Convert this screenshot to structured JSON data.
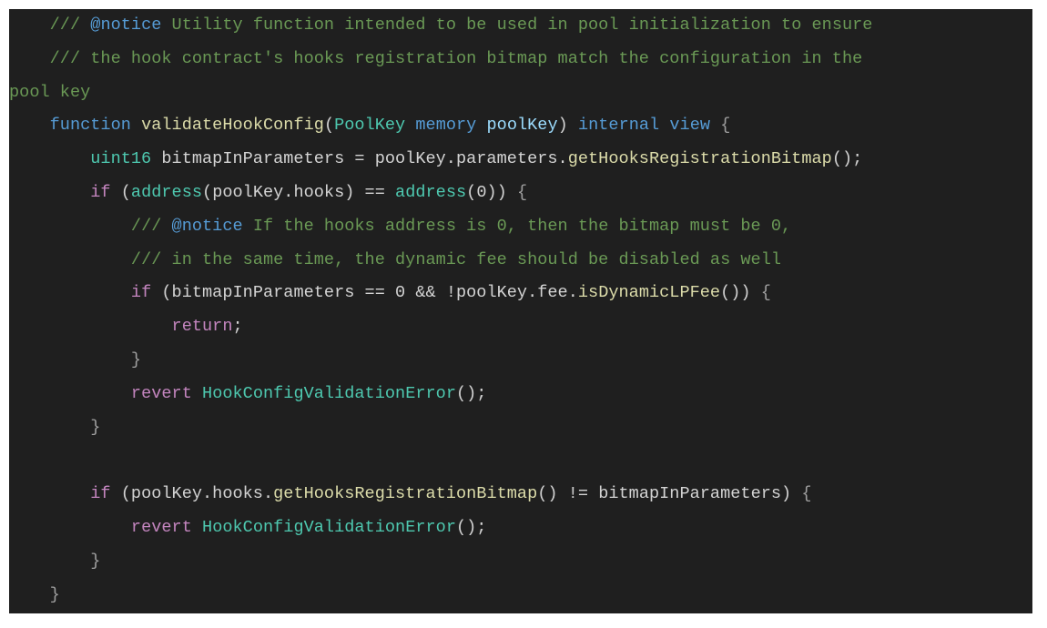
{
  "editor": {
    "language": "solidity",
    "theme": "dark",
    "background": "#1f1f1f",
    "colors": {
      "comment": "#6a9955",
      "doc_tag": "#569cd6",
      "keyword": "#569cd6",
      "control": "#c586c0",
      "type": "#4ec9b0",
      "function": "#dcdcaa",
      "parameter": "#9cdcfe",
      "text": "#d4d4d4",
      "number": "#b5cea8"
    },
    "lines": [
      {
        "indent": "    ",
        "tokens": [
          {
            "text": "/// ",
            "kind": "comment"
          },
          {
            "text": "@notice",
            "kind": "doctag"
          },
          {
            "text": " Utility function intended to be used in pool initialization to ensure",
            "kind": "comment"
          }
        ]
      },
      {
        "indent": "    ",
        "tokens": [
          {
            "text": "/// the hook contract's hooks registration bitmap match the configuration in the",
            "kind": "comment"
          }
        ]
      },
      {
        "indent": "",
        "tokens": [
          {
            "text": "pool key",
            "kind": "comment"
          }
        ]
      },
      {
        "indent": "    ",
        "tokens": [
          {
            "text": "function",
            "kind": "keyword"
          },
          {
            "text": " ",
            "kind": "plain"
          },
          {
            "text": "validateHookConfig",
            "kind": "func"
          },
          {
            "text": "(",
            "kind": "punct"
          },
          {
            "text": "PoolKey",
            "kind": "type"
          },
          {
            "text": " ",
            "kind": "plain"
          },
          {
            "text": "memory",
            "kind": "keyword"
          },
          {
            "text": " ",
            "kind": "plain"
          },
          {
            "text": "poolKey",
            "kind": "param"
          },
          {
            "text": ") ",
            "kind": "punct"
          },
          {
            "text": "internal",
            "kind": "keyword"
          },
          {
            "text": " ",
            "kind": "plain"
          },
          {
            "text": "view",
            "kind": "keyword"
          },
          {
            "text": " {",
            "kind": "brace"
          }
        ]
      },
      {
        "indent": "        ",
        "tokens": [
          {
            "text": "uint16",
            "kind": "type"
          },
          {
            "text": " bitmapInParameters = poolKey.parameters.",
            "kind": "plain"
          },
          {
            "text": "getHooksRegistrationBitmap",
            "kind": "func"
          },
          {
            "text": "();",
            "kind": "punct"
          }
        ]
      },
      {
        "indent": "        ",
        "tokens": [
          {
            "text": "if",
            "kind": "control"
          },
          {
            "text": " (",
            "kind": "punct"
          },
          {
            "text": "address",
            "kind": "type"
          },
          {
            "text": "(poolKey.hooks) == ",
            "kind": "plain"
          },
          {
            "text": "address",
            "kind": "type"
          },
          {
            "text": "(0)) ",
            "kind": "plain"
          },
          {
            "text": "{",
            "kind": "brace"
          }
        ]
      },
      {
        "indent": "            ",
        "tokens": [
          {
            "text": "/// ",
            "kind": "comment"
          },
          {
            "text": "@notice",
            "kind": "doctag"
          },
          {
            "text": " If the hooks address is 0, then the bitmap must be 0,",
            "kind": "comment"
          }
        ]
      },
      {
        "indent": "            ",
        "tokens": [
          {
            "text": "/// in the same time, the dynamic fee should be disabled as well",
            "kind": "comment"
          }
        ]
      },
      {
        "indent": "            ",
        "tokens": [
          {
            "text": "if",
            "kind": "control"
          },
          {
            "text": " (bitmapInParameters == 0 && !poolKey.fee.",
            "kind": "plain"
          },
          {
            "text": "isDynamicLPFee",
            "kind": "func"
          },
          {
            "text": "()) ",
            "kind": "plain"
          },
          {
            "text": "{",
            "kind": "brace"
          }
        ]
      },
      {
        "indent": "                ",
        "tokens": [
          {
            "text": "return",
            "kind": "control"
          },
          {
            "text": ";",
            "kind": "punct"
          }
        ]
      },
      {
        "indent": "            ",
        "tokens": [
          {
            "text": "}",
            "kind": "brace"
          }
        ]
      },
      {
        "indent": "            ",
        "tokens": [
          {
            "text": "revert",
            "kind": "control"
          },
          {
            "text": " ",
            "kind": "plain"
          },
          {
            "text": "HookConfigValidationError",
            "kind": "type"
          },
          {
            "text": "();",
            "kind": "punct"
          }
        ]
      },
      {
        "indent": "        ",
        "tokens": [
          {
            "text": "}",
            "kind": "brace"
          }
        ]
      },
      {
        "indent": "",
        "tokens": []
      },
      {
        "indent": "        ",
        "tokens": [
          {
            "text": "if",
            "kind": "control"
          },
          {
            "text": " (poolKey.hooks.",
            "kind": "plain"
          },
          {
            "text": "getHooksRegistrationBitmap",
            "kind": "func"
          },
          {
            "text": "() != bitmapInParameters) ",
            "kind": "plain"
          },
          {
            "text": "{",
            "kind": "brace"
          }
        ]
      },
      {
        "indent": "            ",
        "tokens": [
          {
            "text": "revert",
            "kind": "control"
          },
          {
            "text": " ",
            "kind": "plain"
          },
          {
            "text": "HookConfigValidationError",
            "kind": "type"
          },
          {
            "text": "();",
            "kind": "punct"
          }
        ]
      },
      {
        "indent": "        ",
        "tokens": [
          {
            "text": "}",
            "kind": "brace"
          }
        ]
      },
      {
        "indent": "    ",
        "tokens": [
          {
            "text": "}",
            "kind": "brace"
          }
        ]
      }
    ]
  }
}
